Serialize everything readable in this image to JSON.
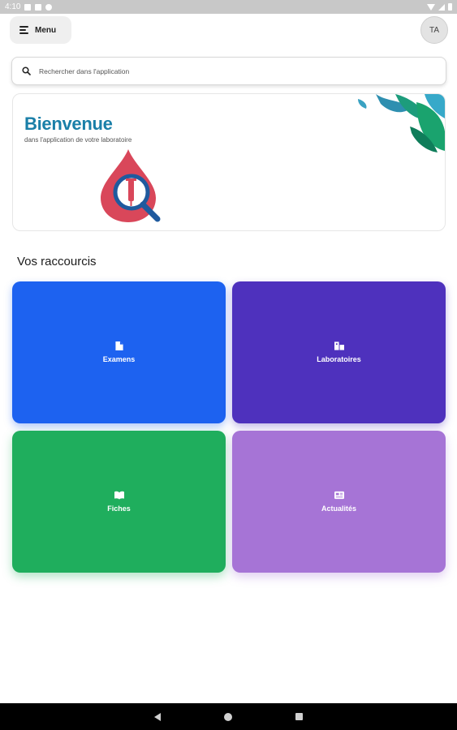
{
  "status_bar": {
    "time": "4:10"
  },
  "header": {
    "menu_label": "Menu",
    "avatar_initials": "TA"
  },
  "search": {
    "placeholder": "Rechercher dans l'application"
  },
  "banner": {
    "title": "Bienvenue",
    "subtitle": "dans l'application de votre laboratoire"
  },
  "shortcuts": {
    "title": "Vos raccourcis",
    "items": [
      {
        "label": "Examens",
        "icon": "file-icon",
        "color": "#1d62f0"
      },
      {
        "label": "Laboratoires",
        "icon": "lab-icon",
        "color": "#4e31bd"
      },
      {
        "label": "Fiches",
        "icon": "book-icon",
        "color": "#1fae5d"
      },
      {
        "label": "Actualités",
        "icon": "news-icon",
        "color": "#a674d6"
      }
    ]
  },
  "colors": {
    "accent_title": "#1a7fa8",
    "drop_red": "#d9475a",
    "magnifier_blue": "#1f5a9e"
  }
}
